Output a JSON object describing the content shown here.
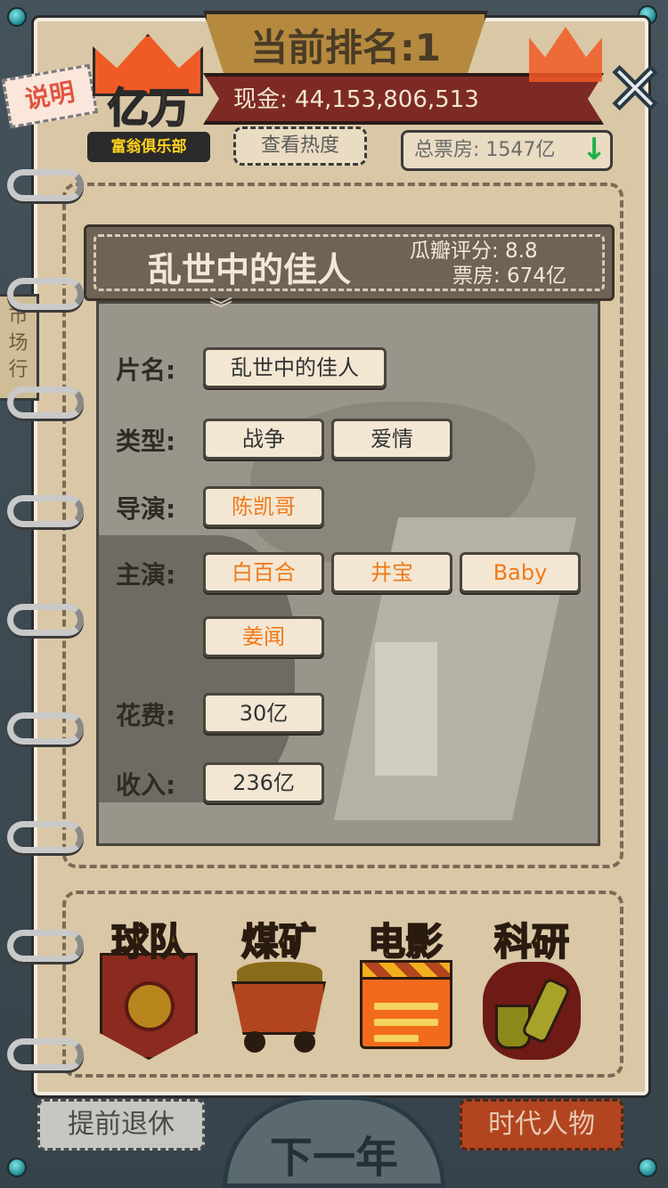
{
  "header": {
    "rank_text": "当前排名:1",
    "cash_text": "现金: 44,153,806,513",
    "heat_button": "查看热度",
    "total_box_office": "总票房: 1547亿",
    "explain_button": "说明",
    "logo": {
      "main": "亿万",
      "sub": "富翁俱乐部"
    },
    "logo_mini": "亿万",
    "close_symbol": "✕"
  },
  "side_tab": {
    "label": "市场行"
  },
  "movie": {
    "title": "乱世中的佳人",
    "rating": "瓜瓣评分: 8.8",
    "box_office": "票房: 674亿",
    "fields": {
      "name_label": "片名:",
      "name_value": "乱世中的佳人",
      "genre_label": "类型:",
      "genres": [
        "战争",
        "爱情"
      ],
      "director_label": "导演:",
      "director": "陈凯哥",
      "cast_label": "主演:",
      "cast": [
        "白百合",
        "井宝",
        "Baby",
        "姜闻"
      ],
      "cost_label": "花费:",
      "cost": "30亿",
      "income_label": "收入:",
      "income": "236亿"
    }
  },
  "categories": [
    {
      "label": "球队",
      "color": "#8a6a1a"
    },
    {
      "label": "煤矿",
      "color": "#8a6a1a"
    },
    {
      "label": "电影",
      "color": "#f6d01d"
    },
    {
      "label": "科研",
      "color": "#8a6a1a"
    }
  ],
  "footer": {
    "retire_button": "提前退休",
    "next_year_button": "下一年",
    "era_button": "时代人物"
  },
  "colors": {
    "orange_text": "#f07a1a",
    "paper": "#d9c7a6",
    "frame": "#3d4a52"
  }
}
